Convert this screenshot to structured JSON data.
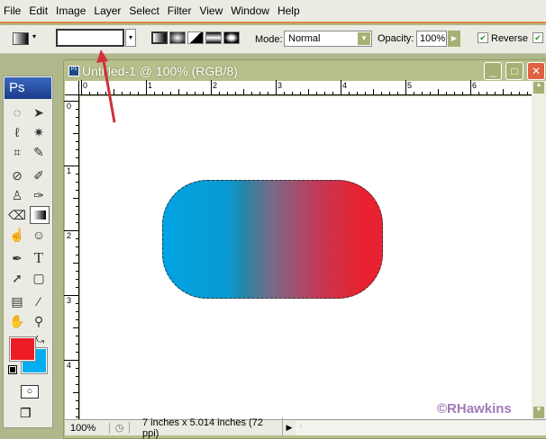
{
  "menu": [
    "File",
    "Edit",
    "Image",
    "Layer",
    "Select",
    "Filter",
    "View",
    "Window",
    "Help"
  ],
  "options": {
    "mode_label": "Mode:",
    "mode_value": "Normal",
    "opacity_label": "Opacity:",
    "opacity_value": "100%",
    "reverse_label": "Reverse",
    "reverse_checked": true,
    "dither_checked": true
  },
  "toolbox": {
    "logo": "Ps",
    "foreground_color": "#ee1c24",
    "background_color": "#00aeef"
  },
  "document": {
    "title": "Untitled-1 @ 100% (RGB/8)",
    "zoom": "100%",
    "doc_info": "7 inches x 5.014 inches (72 ppi)",
    "watermark": "©RHawkins",
    "gradient_colors": [
      "#00a4e4",
      "#e82230"
    ]
  },
  "rulers": {
    "h": [
      "0",
      "1",
      "2",
      "3",
      "4",
      "5",
      "6"
    ],
    "v": [
      "0",
      "1",
      "2",
      "3",
      "4"
    ]
  },
  "annotation_color": "#d0303c"
}
